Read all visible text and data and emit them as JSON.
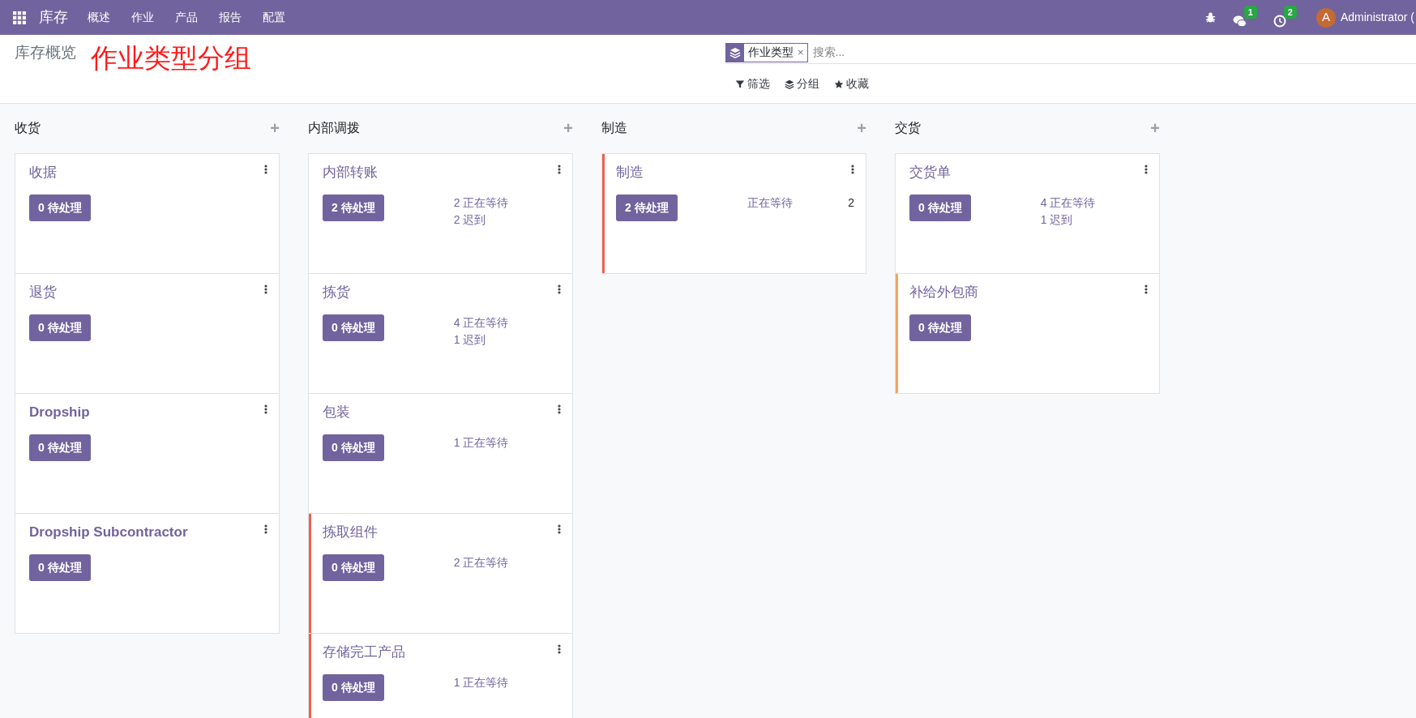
{
  "navbar": {
    "app": "库存",
    "menus": [
      "概述",
      "作业",
      "产品",
      "报告",
      "配置"
    ],
    "messages_count": "1",
    "activities_count": "2",
    "avatar": "A",
    "user": "Administrator ("
  },
  "breadcrumb": "库存概览",
  "annotation": "作业类型分组",
  "search": {
    "facet": "作业类型",
    "remove": "×",
    "placeholder": "搜索...",
    "filters": [
      {
        "kind": "filter",
        "label": "筛选"
      },
      {
        "kind": "group",
        "label": "分组"
      },
      {
        "kind": "favorite",
        "label": "收藏"
      }
    ]
  },
  "columns": [
    {
      "title": "收货",
      "add": "+",
      "cards": [
        {
          "name": "收据",
          "bold": false,
          "button": "0 待处理"
        },
        {
          "name": "退货",
          "bold": false,
          "button": "0 待处理"
        },
        {
          "name": "Dropship",
          "bold": true,
          "button": "0 待处理"
        },
        {
          "name": "Dropship Subcontractor",
          "bold": true,
          "button": "0 待处理"
        }
      ]
    },
    {
      "title": "内部调拨",
      "add": "+",
      "cards": [
        {
          "name": "内部转账",
          "bold": false,
          "button": "2 待处理",
          "stats": [
            {
              "text": "2 正在等待"
            },
            {
              "text": "2 迟到"
            }
          ]
        },
        {
          "name": "拣货",
          "bold": false,
          "button": "0 待处理",
          "stats": [
            {
              "text": "4 正在等待"
            },
            {
              "text": "1 迟到"
            }
          ]
        },
        {
          "name": "包装",
          "bold": false,
          "button": "0 待处理",
          "stats": [
            {
              "text": "1 正在等待"
            }
          ]
        },
        {
          "name": "拣取组件",
          "bold": false,
          "color": "#f06050",
          "button": "0 待处理",
          "stats": [
            {
              "text": "2 正在等待"
            }
          ]
        },
        {
          "name": "存储完工产品",
          "bold": false,
          "color": "#f06050",
          "button": "0 待处理",
          "stats": [
            {
              "text": "1 正在等待"
            }
          ]
        }
      ]
    },
    {
      "title": "制造",
      "add": "+",
      "cards": [
        {
          "name": "制造",
          "bold": false,
          "color": "#f06050",
          "button": "2 待处理",
          "stats": [
            {
              "text": "正在等待",
              "value": "2"
            }
          ]
        }
      ]
    },
    {
      "title": "交货",
      "add": "+",
      "cards": [
        {
          "name": "交货单",
          "bold": false,
          "button": "0 待处理",
          "stats": [
            {
              "text": "4 正在等待"
            },
            {
              "text": "1 迟到"
            }
          ]
        },
        {
          "name": "补给外包商",
          "bold": false,
          "color": "#f4a460",
          "button": "0 待处理"
        }
      ]
    }
  ]
}
